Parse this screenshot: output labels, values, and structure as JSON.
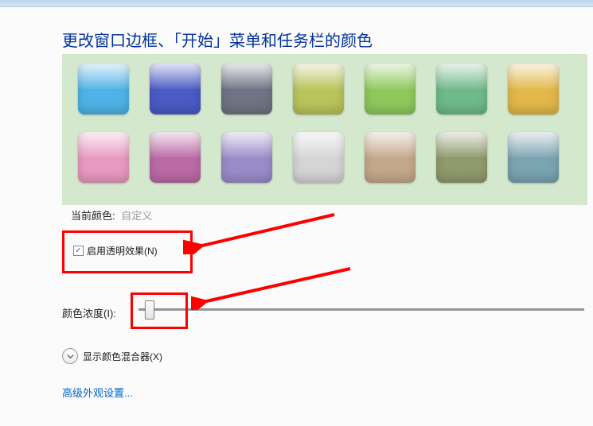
{
  "title": "更改窗口边框、「开始」菜单和任务栏的颜色",
  "palette": {
    "row1": [
      "#4fb3e8",
      "#4a5bc4",
      "#6e7483",
      "#b9c45a",
      "#8fc95c",
      "#6fba89",
      "#e2b84a"
    ],
    "row2": [
      "#e89ac0",
      "#bb6aa6",
      "#9a8cc8",
      "#d5d5d5",
      "#c5a88a",
      "#909a6d",
      "#7aa4b1"
    ]
  },
  "currentColor": {
    "label": "当前颜色:",
    "value": "自定义"
  },
  "transparency": {
    "checked": true,
    "label": "启用透明效果(N)"
  },
  "intensity": {
    "label": "颜色浓度(I):"
  },
  "expander": {
    "label": "显示颜色混合器(X)"
  },
  "advancedLink": "高级外观设置...",
  "annotation_arrows": {
    "color": "#ff0000"
  }
}
